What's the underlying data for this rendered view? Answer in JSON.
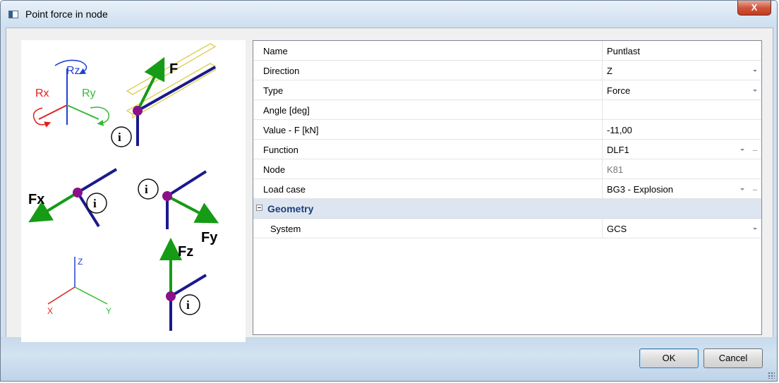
{
  "window": {
    "title": "Point force in node",
    "close_glyph": "X"
  },
  "properties": [
    {
      "label": "Name",
      "value": "Puntlast",
      "dropdown": false,
      "ellipsis": false,
      "readonly": false
    },
    {
      "label": "Direction",
      "value": "Z",
      "dropdown": true,
      "ellipsis": false,
      "readonly": false
    },
    {
      "label": "Type",
      "value": "Force",
      "dropdown": true,
      "ellipsis": false,
      "readonly": false
    },
    {
      "label": "Angle [deg]",
      "value": "",
      "dropdown": false,
      "ellipsis": false,
      "readonly": false
    },
    {
      "label": "Value - F [kN]",
      "value": "-11,00",
      "dropdown": false,
      "ellipsis": false,
      "readonly": false
    },
    {
      "label": "Function",
      "value": "DLF1",
      "dropdown": true,
      "ellipsis": true,
      "readonly": false
    },
    {
      "label": "Node",
      "value": "K81",
      "dropdown": false,
      "ellipsis": false,
      "readonly": true
    },
    {
      "label": "Load case",
      "value": "BG3 - Explosion",
      "dropdown": true,
      "ellipsis": true,
      "readonly": false
    }
  ],
  "geometry": {
    "section_label": "Geometry",
    "rows": [
      {
        "label": "System",
        "value": "GCS",
        "dropdown": true
      }
    ]
  },
  "illustration": {
    "rotation_labels": {
      "rz": "Rz",
      "rx": "Rx",
      "ry": "Ry"
    },
    "force_labels": {
      "f": "F",
      "fx": "Fx",
      "fy": "Fy",
      "fz": "Fz"
    },
    "node_marker": "i",
    "axis_labels": {
      "z": "Z",
      "x": "X",
      "y": "Y"
    }
  },
  "buttons": {
    "ok": "OK",
    "cancel": "Cancel",
    "ellipsis": "..."
  },
  "colors": {
    "member": "#1a1a8c",
    "force": "#169b16",
    "node": "#8a118a",
    "rot_x": "#e02020",
    "rot_y": "#33bb33",
    "rot_z": "#2040d0",
    "beam": "#e6d84a"
  }
}
